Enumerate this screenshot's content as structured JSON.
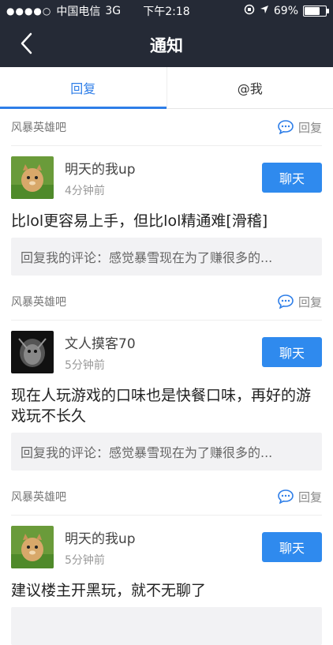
{
  "status_bar": {
    "carrier": "中国电信",
    "network": "3G",
    "time": "下午2:18",
    "battery": "69%",
    "battery_level": 0.69
  },
  "nav": {
    "title": "通知"
  },
  "tabs": [
    {
      "label": "回复"
    },
    {
      "label": "@我"
    }
  ],
  "items": [
    {
      "forum": "风暴英雄吧",
      "reply_label": "回复",
      "user": "明天的我up",
      "time": "4分钟前",
      "chat_label": "聊天",
      "comment": "比lol更容易上手，但比lol精通难[滑稽]",
      "quote": "回复我的评论：感觉暴雪现在为了赚很多的..."
    },
    {
      "forum": "风暴英雄吧",
      "reply_label": "回复",
      "user": "文人摸客70",
      "time": "5分钟前",
      "chat_label": "聊天",
      "comment": "现在人玩游戏的口味也是快餐口味，再好的游戏玩不长久",
      "quote": "回复我的评论：感觉暴雪现在为了赚很多的..."
    },
    {
      "forum": "风暴英雄吧",
      "reply_label": "回复",
      "user": "明天的我up",
      "time": "5分钟前",
      "chat_label": "聊天",
      "comment": "建议楼主开黑玩，就不无聊了",
      "quote": ""
    }
  ]
}
